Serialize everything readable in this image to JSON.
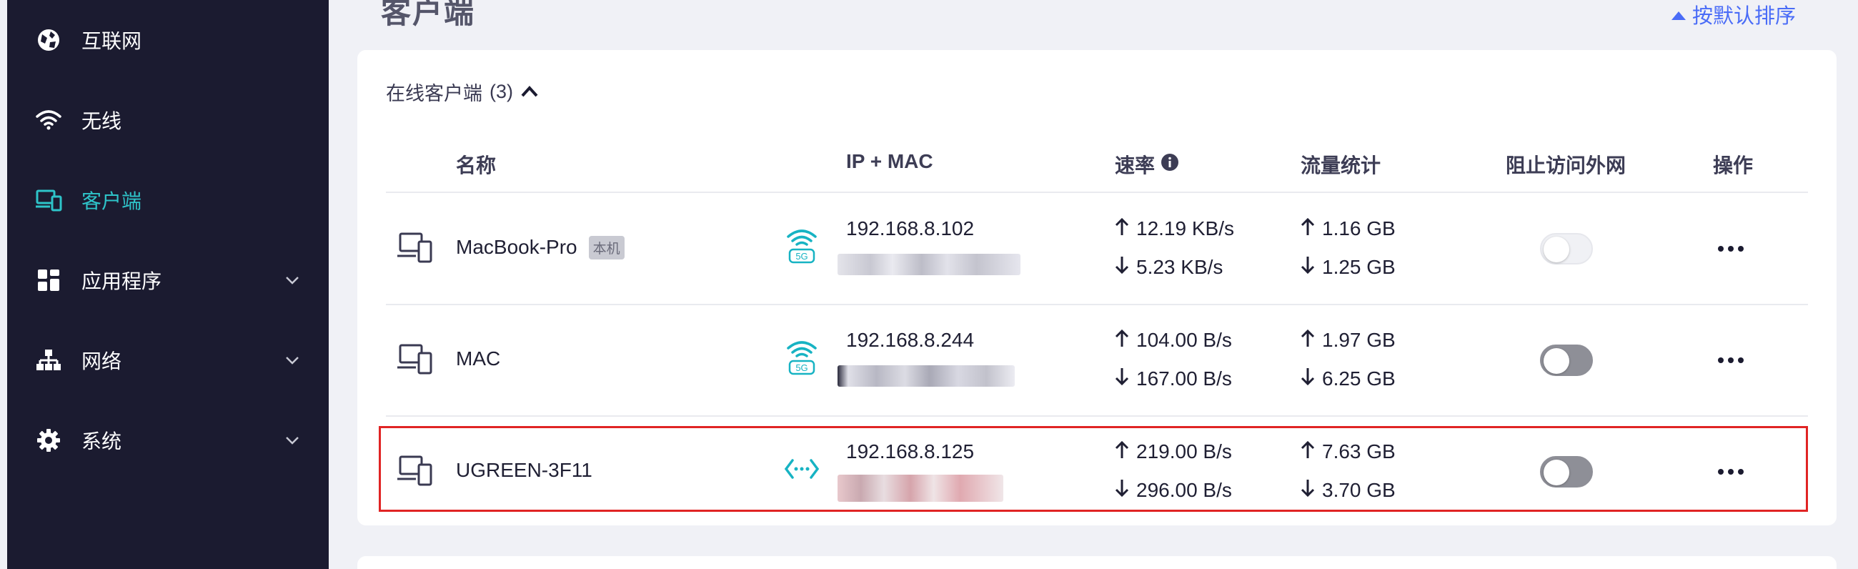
{
  "sidebar": {
    "items": [
      {
        "label": "互联网",
        "icon": "globe-icon"
      },
      {
        "label": "无线",
        "icon": "wifi-icon"
      },
      {
        "label": "客户端",
        "icon": "devices-icon",
        "active": true
      },
      {
        "label": "应用程序",
        "icon": "apps-icon",
        "expandable": true
      },
      {
        "label": "网络",
        "icon": "network-icon",
        "expandable": true
      },
      {
        "label": "系统",
        "icon": "gear-icon",
        "expandable": true
      }
    ]
  },
  "page": {
    "title": "客户端",
    "sort_label": "按默认排序"
  },
  "clients": {
    "section_title": "在线客户端",
    "count": "(3)",
    "columns": {
      "name": "名称",
      "ip_mac": "IP + MAC",
      "rate": "速率",
      "traffic": "流量统计",
      "block": "阻止访问外网",
      "actions": "操作"
    },
    "rows": [
      {
        "name": "MacBook-Pro",
        "badge": "本机",
        "connection": "wifi-5g-icon",
        "connection_label": "5G",
        "ip": "192.168.8.102",
        "speed_up": "12.19 KB/s",
        "speed_down": "5.23 KB/s",
        "traffic_up": "1.16 GB",
        "traffic_down": "1.25 GB",
        "blocked": false
      },
      {
        "name": "MAC",
        "badge": "",
        "connection": "wifi-5g-icon",
        "connection_label": "5G",
        "ip": "192.168.8.244",
        "speed_up": "104.00 B/s",
        "speed_down": "167.00 B/s",
        "traffic_up": "1.97 GB",
        "traffic_down": "6.25 GB",
        "blocked": false
      },
      {
        "name": "UGREEN-3F11",
        "badge": "",
        "connection": "ethernet-icon",
        "connection_label": "",
        "ip": "192.168.8.125",
        "speed_up": "219.00 B/s",
        "speed_down": "296.00 B/s",
        "traffic_up": "7.63 GB",
        "traffic_down": "3.70 GB",
        "blocked": false
      }
    ]
  },
  "colors": {
    "accent": "#2ec4c9",
    "sidebar_bg": "#1b1b30",
    "link": "#4a6cf7",
    "highlight": "#e02424"
  }
}
